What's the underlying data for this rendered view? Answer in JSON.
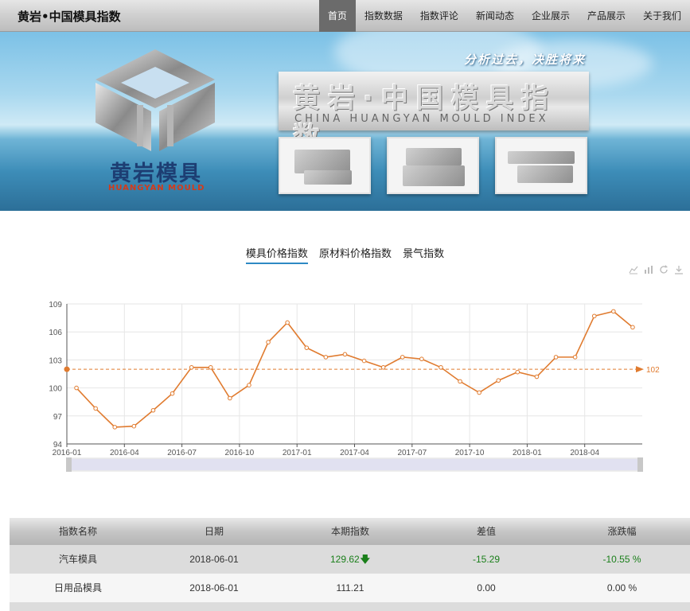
{
  "header": {
    "site_title": "黄岩•中国模具指数",
    "nav": [
      {
        "label": "首页",
        "active": true
      },
      {
        "label": "指数数据",
        "active": false
      },
      {
        "label": "指数评论",
        "active": false
      },
      {
        "label": "新闻动态",
        "active": false
      },
      {
        "label": "企业展示",
        "active": false
      },
      {
        "label": "产品展示",
        "active": false
      },
      {
        "label": "关于我们",
        "active": false
      }
    ]
  },
  "banner": {
    "slogan": "分析过去，决胜将来",
    "title_cn": "黄岩·中国模具指数",
    "title_en": "CHINA HUANGYAN MOULD INDEX",
    "brand_cn": "黄岩模具",
    "brand_en": "HUANGYAN MOULD"
  },
  "tabs": [
    {
      "label": "模具价格指数",
      "active": true
    },
    {
      "label": "原材料价格指数",
      "active": false
    },
    {
      "label": "景气指数",
      "active": false
    }
  ],
  "toolbox": [
    "line-chart-icon",
    "bar-chart-icon",
    "refresh-icon",
    "download-icon"
  ],
  "chart_data": {
    "type": "line",
    "x": [
      "2016-01",
      "2016-02",
      "2016-03",
      "2016-04",
      "2016-05",
      "2016-06",
      "2016-07",
      "2016-08",
      "2016-09",
      "2016-10",
      "2016-11",
      "2016-12",
      "2017-01",
      "2017-02",
      "2017-03",
      "2017-04",
      "2017-05",
      "2017-06",
      "2017-07",
      "2017-08",
      "2017-09",
      "2017-10",
      "2017-11",
      "2017-12",
      "2018-01",
      "2018-02",
      "2018-03",
      "2018-04",
      "2018-05",
      "2018-06"
    ],
    "x_tick_labels": [
      "2016-01",
      "2016-04",
      "2016-07",
      "2016-10",
      "2017-01",
      "2017-04",
      "2017-07",
      "2017-10",
      "2018-01",
      "2018-04"
    ],
    "series": [
      {
        "values": [
          100.0,
          97.8,
          95.8,
          95.9,
          97.6,
          99.4,
          102.2,
          102.2,
          98.9,
          100.3,
          104.9,
          107.0,
          104.3,
          103.3,
          103.6,
          102.9,
          102.2,
          103.3,
          103.1,
          102.2,
          100.7,
          99.5,
          100.8,
          101.7,
          101.2,
          103.3,
          103.3,
          107.7,
          108.2,
          106.5
        ]
      }
    ],
    "reference_line": {
      "value": 102,
      "label": "102"
    },
    "ylim": [
      94,
      109
    ],
    "y_ticks": [
      94,
      97,
      100,
      103,
      106,
      109
    ],
    "color": "#e07b2f",
    "grid": true
  },
  "table": {
    "headers": [
      "指数名称",
      "日期",
      "本期指数",
      "差值",
      "涨跌幅"
    ],
    "rows": [
      {
        "name": "汽车模具",
        "date": "2018-06-01",
        "value": "129.62",
        "diff": "-15.29",
        "pct": "-10.55 %"
      },
      {
        "name": "日用品模具",
        "date": "2018-06-01",
        "value": "111.21",
        "diff": "0.00",
        "pct": "0.00 %"
      }
    ]
  }
}
